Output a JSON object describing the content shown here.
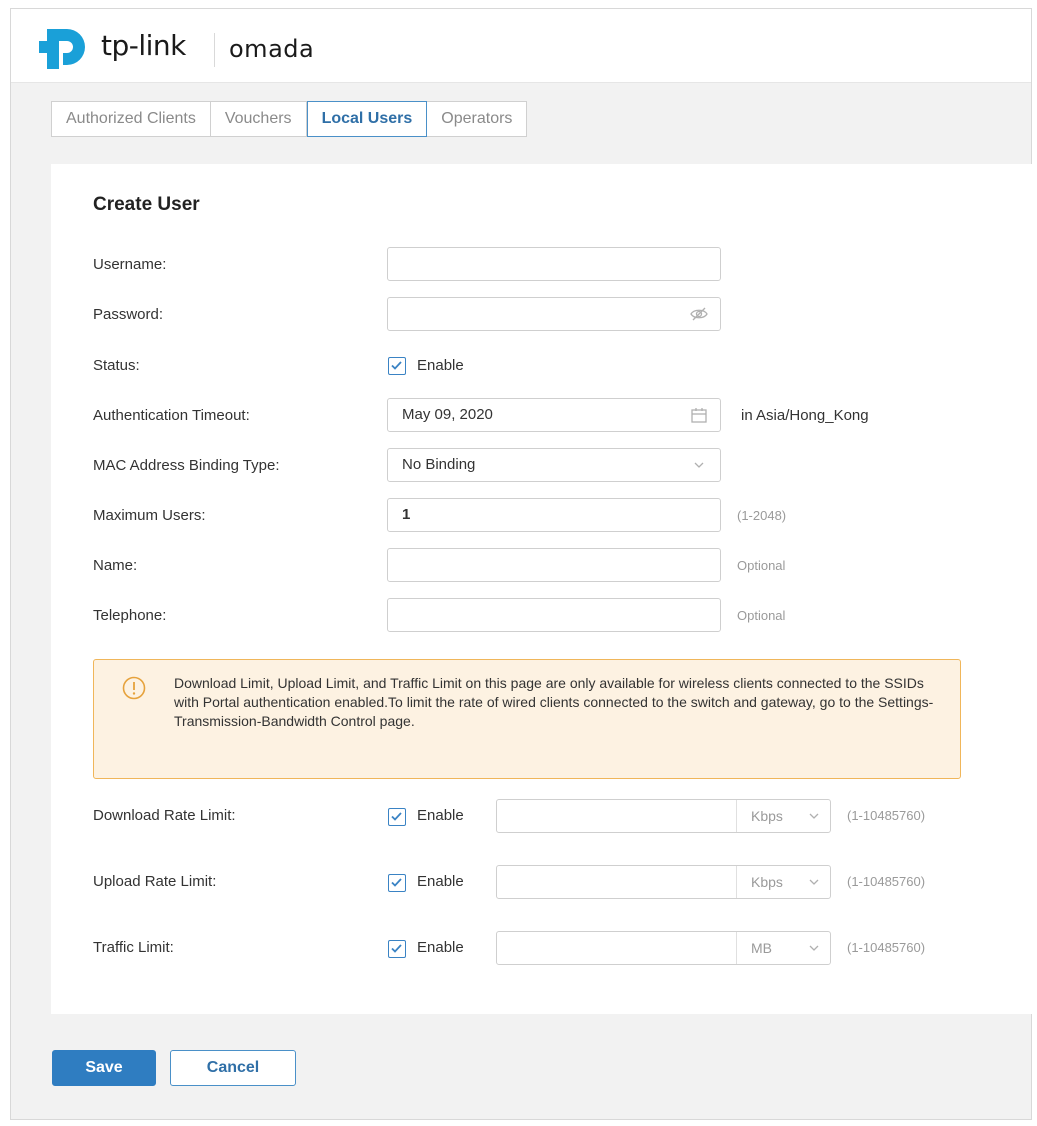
{
  "brand": {
    "company": "tp-link",
    "product": "omada",
    "accent_color": "#2f7dc1",
    "logo_color": "#1aa0d8"
  },
  "tabs": [
    {
      "label": "Authorized Clients",
      "active": false
    },
    {
      "label": "Vouchers",
      "active": false
    },
    {
      "label": "Local Users",
      "active": true
    },
    {
      "label": "Operators",
      "active": false
    }
  ],
  "form": {
    "title": "Create User",
    "username": {
      "label": "Username:",
      "value": ""
    },
    "password": {
      "label": "Password:",
      "value": "",
      "icon": "eye-off-icon"
    },
    "status": {
      "label": "Status:",
      "checkbox_label": "Enable",
      "checked": true
    },
    "auth_timeout": {
      "label": "Authentication Timeout:",
      "value": "May 09, 2020",
      "icon": "calendar-icon",
      "suffix": "in Asia/Hong_Kong"
    },
    "mac_binding": {
      "label": "MAC Address Binding Type:",
      "value": "No Binding",
      "icon": "chevron-down-icon"
    },
    "max_users": {
      "label": "Maximum Users:",
      "value": "1",
      "hint": "(1-2048)"
    },
    "name": {
      "label": "Name:",
      "value": "",
      "hint": "Optional"
    },
    "telephone": {
      "label": "Telephone:",
      "value": "",
      "hint": "Optional"
    }
  },
  "warning": {
    "icon": "warning-icon",
    "text": "Download Limit, Upload Limit, and Traffic Limit on this page are only available for wireless clients connected to the SSIDs with Portal authentication enabled.To limit the rate of wired clients connected to the switch and gateway, go to the Settings-Transmission-Bandwidth Control page.",
    "color": "#f0b65a"
  },
  "limits": [
    {
      "label": "Download Rate Limit:",
      "checkbox_label": "Enable",
      "checked": true,
      "value": "",
      "unit": "Kbps",
      "hint": "(1-10485760)"
    },
    {
      "label": "Upload Rate Limit:",
      "checkbox_label": "Enable",
      "checked": true,
      "value": "",
      "unit": "Kbps",
      "hint": "(1-10485760)"
    },
    {
      "label": "Traffic Limit:",
      "checkbox_label": "Enable",
      "checked": true,
      "value": "",
      "unit": "MB",
      "hint": "(1-10485760)"
    }
  ],
  "actions": {
    "save_label": "Save",
    "cancel_label": "Cancel"
  }
}
